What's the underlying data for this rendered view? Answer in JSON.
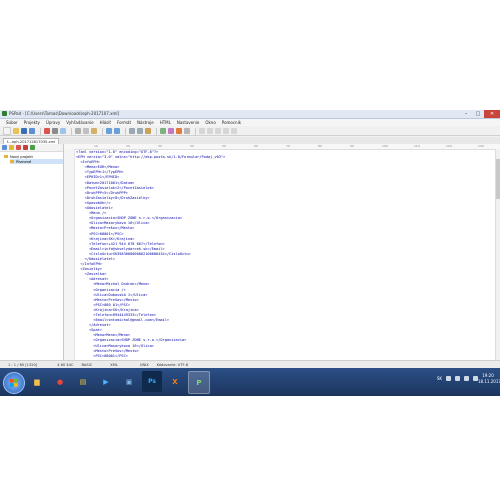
{
  "window": {
    "title": "PSPad - [C:\\Users\\Tomas\\Downloads\\eph-2017107.xml]",
    "buttons": {
      "minimize": "–",
      "maximize": "□",
      "close": "✕"
    }
  },
  "menu": [
    "Súbor",
    "Projekty",
    "Úpravy",
    "Vyhľadávanie",
    "Hlásiť",
    "Formát",
    "Nástroje",
    "HTML",
    "Nastavenie",
    "Okno",
    "Pomocník"
  ],
  "tab": {
    "label": "t...eph-201712817035.xml"
  },
  "sidebar": {
    "project_label": "Nový projekt",
    "selected_item": "Písmené"
  },
  "editor": {
    "ruler_marks": [
      "10",
      "20",
      "30",
      "40",
      "50",
      "60",
      "70",
      "80",
      "90",
      "100",
      "110",
      "120",
      "130"
    ],
    "lines": [
      "<?xml version=\"1.0\" encoding=\"UTF-8\"?>",
      "<EPH verzia=\"3.0\" xmlns=\"http://ekp.posta.sk/1.0/Formular/Podaj_v03\">",
      "  <InfoEPH>",
      "    <Mena>EUR</Mena>",
      "    <TypEPH>1</TypEPH>",
      "    <EPHID>1</EPHID>",
      "    <Datum>20171001</Datum>",
      "    <PocetZasielok>2</PocetZasielok>",
      "    <DruhPPP>5</DruhPPP>",
      "    <DruhZasielky>8</DruhZasielky>",
      "    <SposobUhr/>",
      "    <Odosielatel>",
      "      <Meno />",
      "      <Organizacia>SHOP ZONE s.r.o.</Organizacia>",
      "      <Ulica>Masarykova 16</Ulica>",
      "      <Mesto>Prešov</Mesto>",
      "      <PSC>08001</PSC>",
      "      <Krajina>SK</Krajina>",
      "      <Telefon>+421 944 078 667</Telefon>",
      "      <Email>info@skvelydarcek.sk</Email>",
      "      <CisloUctu>SK3583000000002100680434</CisloUctu>",
      "    </Odosielatel>",
      "  </InfoEPH>",
      "  <Zasielky>",
      "    <Zasielka>",
      "      <Adresat>",
      "        <Meno>Michal Ondrok</Meno>",
      "        <Organizacia />",
      "        <Ulica>Dubovská 1</Ulica>",
      "        <Mesto>Prešov</Mesto>",
      "        <PSC>080 01</PSC>",
      "        <Krajina>SK</Krajina>",
      "        <Telefon>0944449333</Telefon>",
      "        <Email>ontomichal@gmail.com</Email>",
      "      </Adresat>",
      "      <Spat>",
      "        <Meno>Meno</Meno>",
      "        <Organizacia>SHOP ZONE s.r.o.</Organizacia>",
      "        <Ulica>Masarykova 16</Ulica>",
      "        <Mesto>Prešov</Mesto>",
      "        <PSC>08001</PSC>"
    ]
  },
  "status": {
    "position": "1 : 1 / 80 [1320]",
    "col": "4  80  $4C",
    "mode": "BASIC",
    "syntax": "XML",
    "eol": "UNIX",
    "encoding": "Kódovanie: UTF-8"
  },
  "taskbar": {
    "apps": [
      {
        "icon": "folder-icon",
        "glyph": "▆"
      },
      {
        "icon": "chrome-icon",
        "glyph": "●"
      },
      {
        "icon": "explorer-icon",
        "glyph": "▤"
      },
      {
        "icon": "media-icon",
        "glyph": "▶"
      },
      {
        "icon": "app-icon",
        "glyph": "▣"
      },
      {
        "icon": "photoshop-icon",
        "glyph": "Ps"
      },
      {
        "icon": "xampp-icon",
        "glyph": "X"
      },
      {
        "icon": "pspad-icon",
        "glyph": "P"
      }
    ],
    "lang": "SK",
    "time": "19:20",
    "date": "18.11.2017"
  }
}
